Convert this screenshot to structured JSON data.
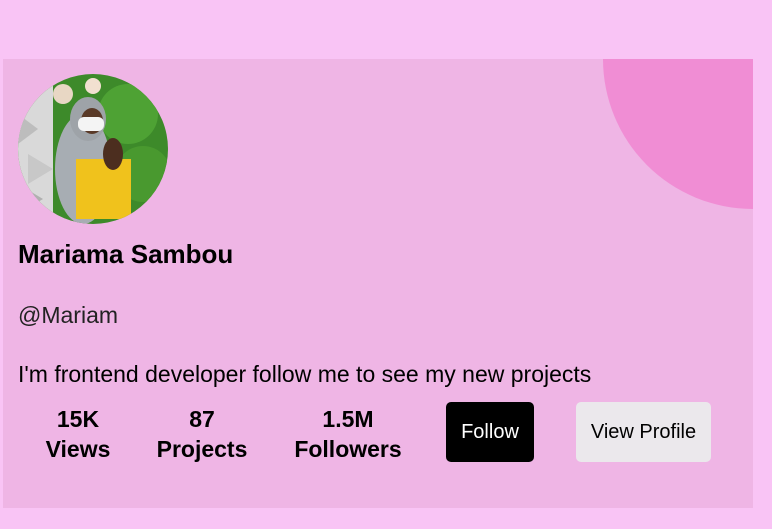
{
  "profile": {
    "avatar_alt": "profile photo",
    "name": "Mariama Sambou",
    "handle": "@Mariam",
    "bio": "I'm frontend developer follow me to see my new projects"
  },
  "stats": [
    {
      "value": "15K",
      "label": "Views"
    },
    {
      "value": "87",
      "label": "Projects"
    },
    {
      "value": "1.5M",
      "label": "Followers"
    }
  ],
  "actions": {
    "follow_label": "Follow",
    "view_profile_label": "View Profile"
  },
  "colors": {
    "page_background": "#f9c4f5",
    "card_background": "#efb5e5",
    "corner_accent": "#f08dd4",
    "follow_button": "#000000",
    "view_profile_button": "#ebe8ec"
  }
}
